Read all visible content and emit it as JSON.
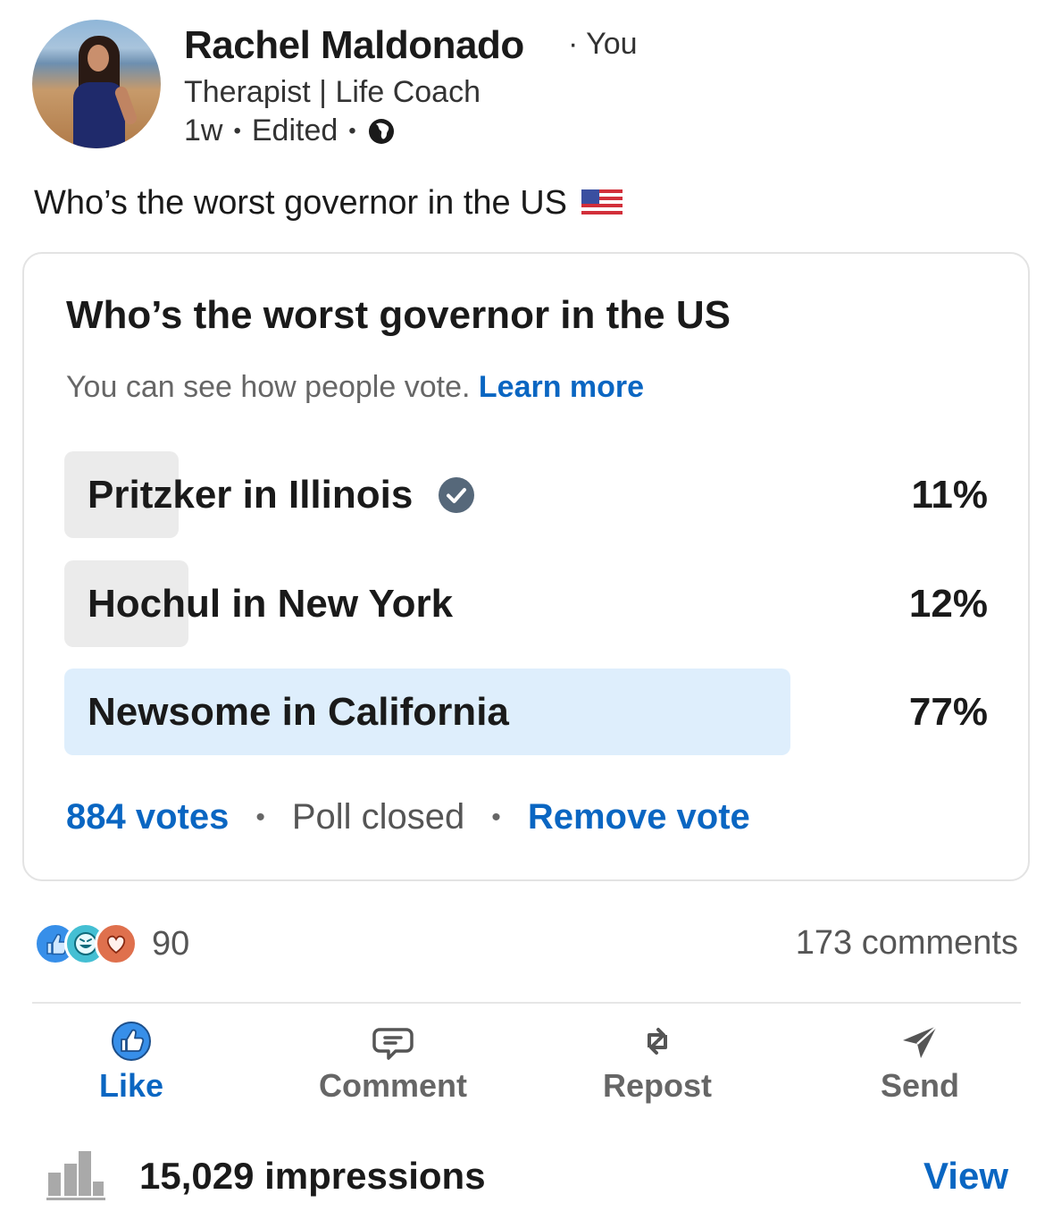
{
  "author": {
    "name": "Rachel Maldonado",
    "you_label": "· You",
    "headline": "Therapist | Life Coach",
    "time": "1w",
    "sep1": "•",
    "edited": "Edited",
    "sep2": "•",
    "visibility_icon": "globe-icon"
  },
  "post": {
    "text": "Who’s the worst governor in the US",
    "emoji_icon": "us-flag-icon"
  },
  "poll": {
    "question": "Who’s the worst governor in the US",
    "note": "You can see how people vote.",
    "learn_more": "Learn more",
    "options": [
      {
        "label": "Pritzker in Illinois",
        "percent_label": "11%",
        "percent": 11,
        "voted": true,
        "winner": false
      },
      {
        "label": "Hochul in New York",
        "percent_label": "12%",
        "percent": 12,
        "voted": false,
        "winner": false
      },
      {
        "label": "Newsome in California",
        "percent_label": "77%",
        "percent": 77,
        "voted": false,
        "winner": true
      }
    ],
    "votes": "884 votes",
    "status": "Poll closed",
    "remove_vote": "Remove vote",
    "dot": "•"
  },
  "social": {
    "reaction_icons": [
      "like-reaction-icon",
      "funny-reaction-icon",
      "love-reaction-icon"
    ],
    "reaction_count": "90",
    "comments": "173 comments"
  },
  "actions": [
    {
      "label": "Like",
      "icon": "like-icon",
      "active": true
    },
    {
      "label": "Comment",
      "icon": "comment-icon",
      "active": false
    },
    {
      "label": "Repost",
      "icon": "repost-icon",
      "active": false
    },
    {
      "label": "Send",
      "icon": "send-icon",
      "active": false
    }
  ],
  "impressions": {
    "text": "15,029 impressions",
    "view": "View",
    "icon": "bar-chart-icon"
  },
  "colors": {
    "brand_blue": "#0a66c2",
    "winner_fill": "#deeefc",
    "loser_fill": "#ebebeb"
  }
}
